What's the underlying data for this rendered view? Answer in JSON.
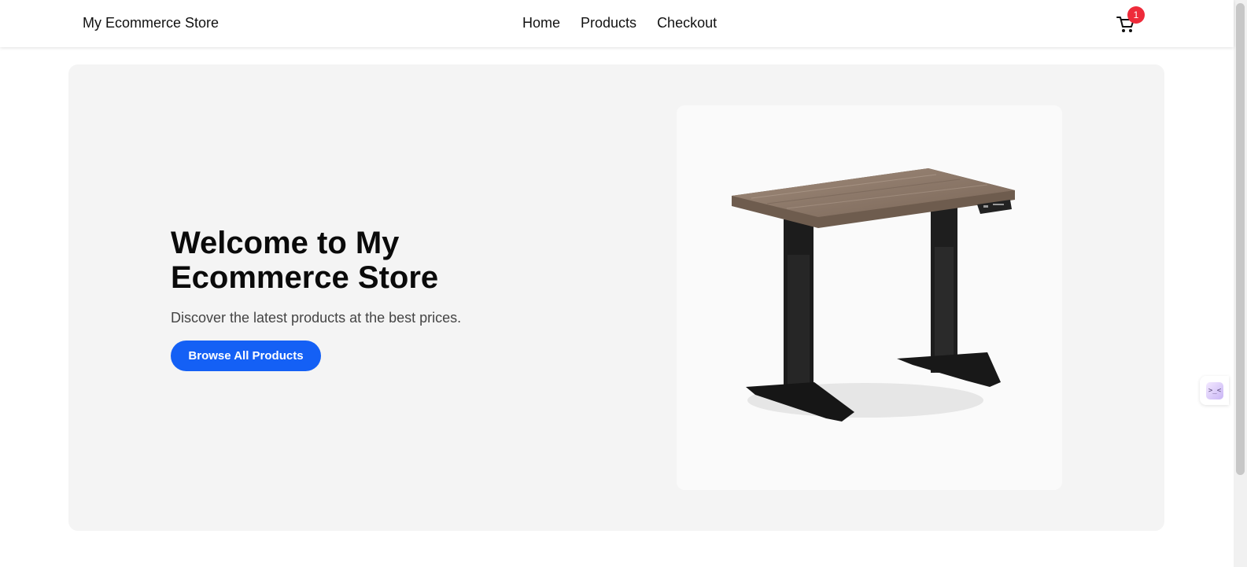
{
  "header": {
    "brand": "My Ecommerce Store",
    "nav": [
      {
        "label": "Home"
      },
      {
        "label": "Products"
      },
      {
        "label": "Checkout"
      }
    ],
    "cart": {
      "count": "1",
      "icon": "cart-icon",
      "badge_color": "#ee2b3a"
    }
  },
  "hero": {
    "title": "Welcome to My Ecommerce Store",
    "subtitle": "Discover the latest products at the best prices.",
    "button_label": "Browse All Products",
    "button_color": "#1460f5",
    "image": {
      "icon": "standing-desk-image"
    }
  },
  "side_widget": {
    "icon": "assistant-widget-icon",
    "glyph": ">_<"
  }
}
